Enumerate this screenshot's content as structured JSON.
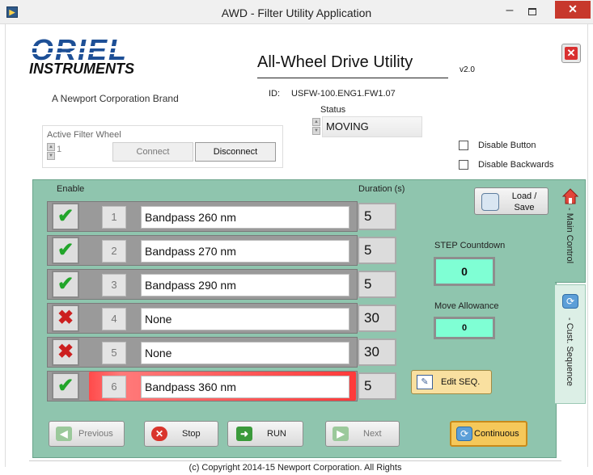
{
  "window": {
    "title": "AWD - Filter Utility Application",
    "app_icon": "app-icon",
    "minimize": "–",
    "close": "✕"
  },
  "header": {
    "logo_word": "ORIEL",
    "logo_sub": "INSTRUMENTS",
    "brand": "A Newport Corporation Brand",
    "app_title": "All-Wheel Drive Utility",
    "version": "v2.0",
    "id_label": "ID:",
    "id_value": "USFW-100.ENG1.FW1.07",
    "status_label": "Status",
    "status_value": "MOVING"
  },
  "connection": {
    "active_label": "Active Filter Wheel",
    "active_value": "1",
    "connect_label": "Connect",
    "disconnect_label": "Disconnect"
  },
  "options": {
    "disable_button": "Disable Button",
    "disable_backwards": "Disable Backwards"
  },
  "table": {
    "enable_header": "Enable",
    "duration_header": "Duration (s)",
    "rows": [
      {
        "enabled": true,
        "num": "1",
        "name": "Bandpass 260 nm",
        "duration": "5"
      },
      {
        "enabled": true,
        "num": "2",
        "name": "Bandpass 270 nm",
        "duration": "5"
      },
      {
        "enabled": true,
        "num": "3",
        "name": "Bandpass 290 nm",
        "duration": "5"
      },
      {
        "enabled": false,
        "num": "4",
        "name": "None",
        "duration": "30"
      },
      {
        "enabled": false,
        "num": "5",
        "name": "None",
        "duration": "30"
      },
      {
        "enabled": true,
        "num": "6",
        "name": "Bandpass 360 nm",
        "duration": "5",
        "active": true
      }
    ]
  },
  "side": {
    "load_label_1": "Load /",
    "load_label_2": "Save",
    "step_label": "STEP Countdown",
    "step_value": "0",
    "allow_label": "Move Allowance",
    "allow_value": "0",
    "edit_label": "Edit SEQ."
  },
  "tabs": {
    "main": "- Main Control",
    "cust": "- Cust. Sequence"
  },
  "buttons": {
    "previous": "Previous",
    "stop": "Stop",
    "run": "RUN",
    "next": "Next",
    "continuous": "Continuous"
  },
  "footer": "(c) Copyright 2014-15   Newport Corporation. All Rights",
  "colors": {
    "panel": "#8fc5ae",
    "readout": "#7fffd4",
    "check": "#22a52a",
    "cross": "#cc1f1f",
    "active_row": "#ff3a3a"
  }
}
